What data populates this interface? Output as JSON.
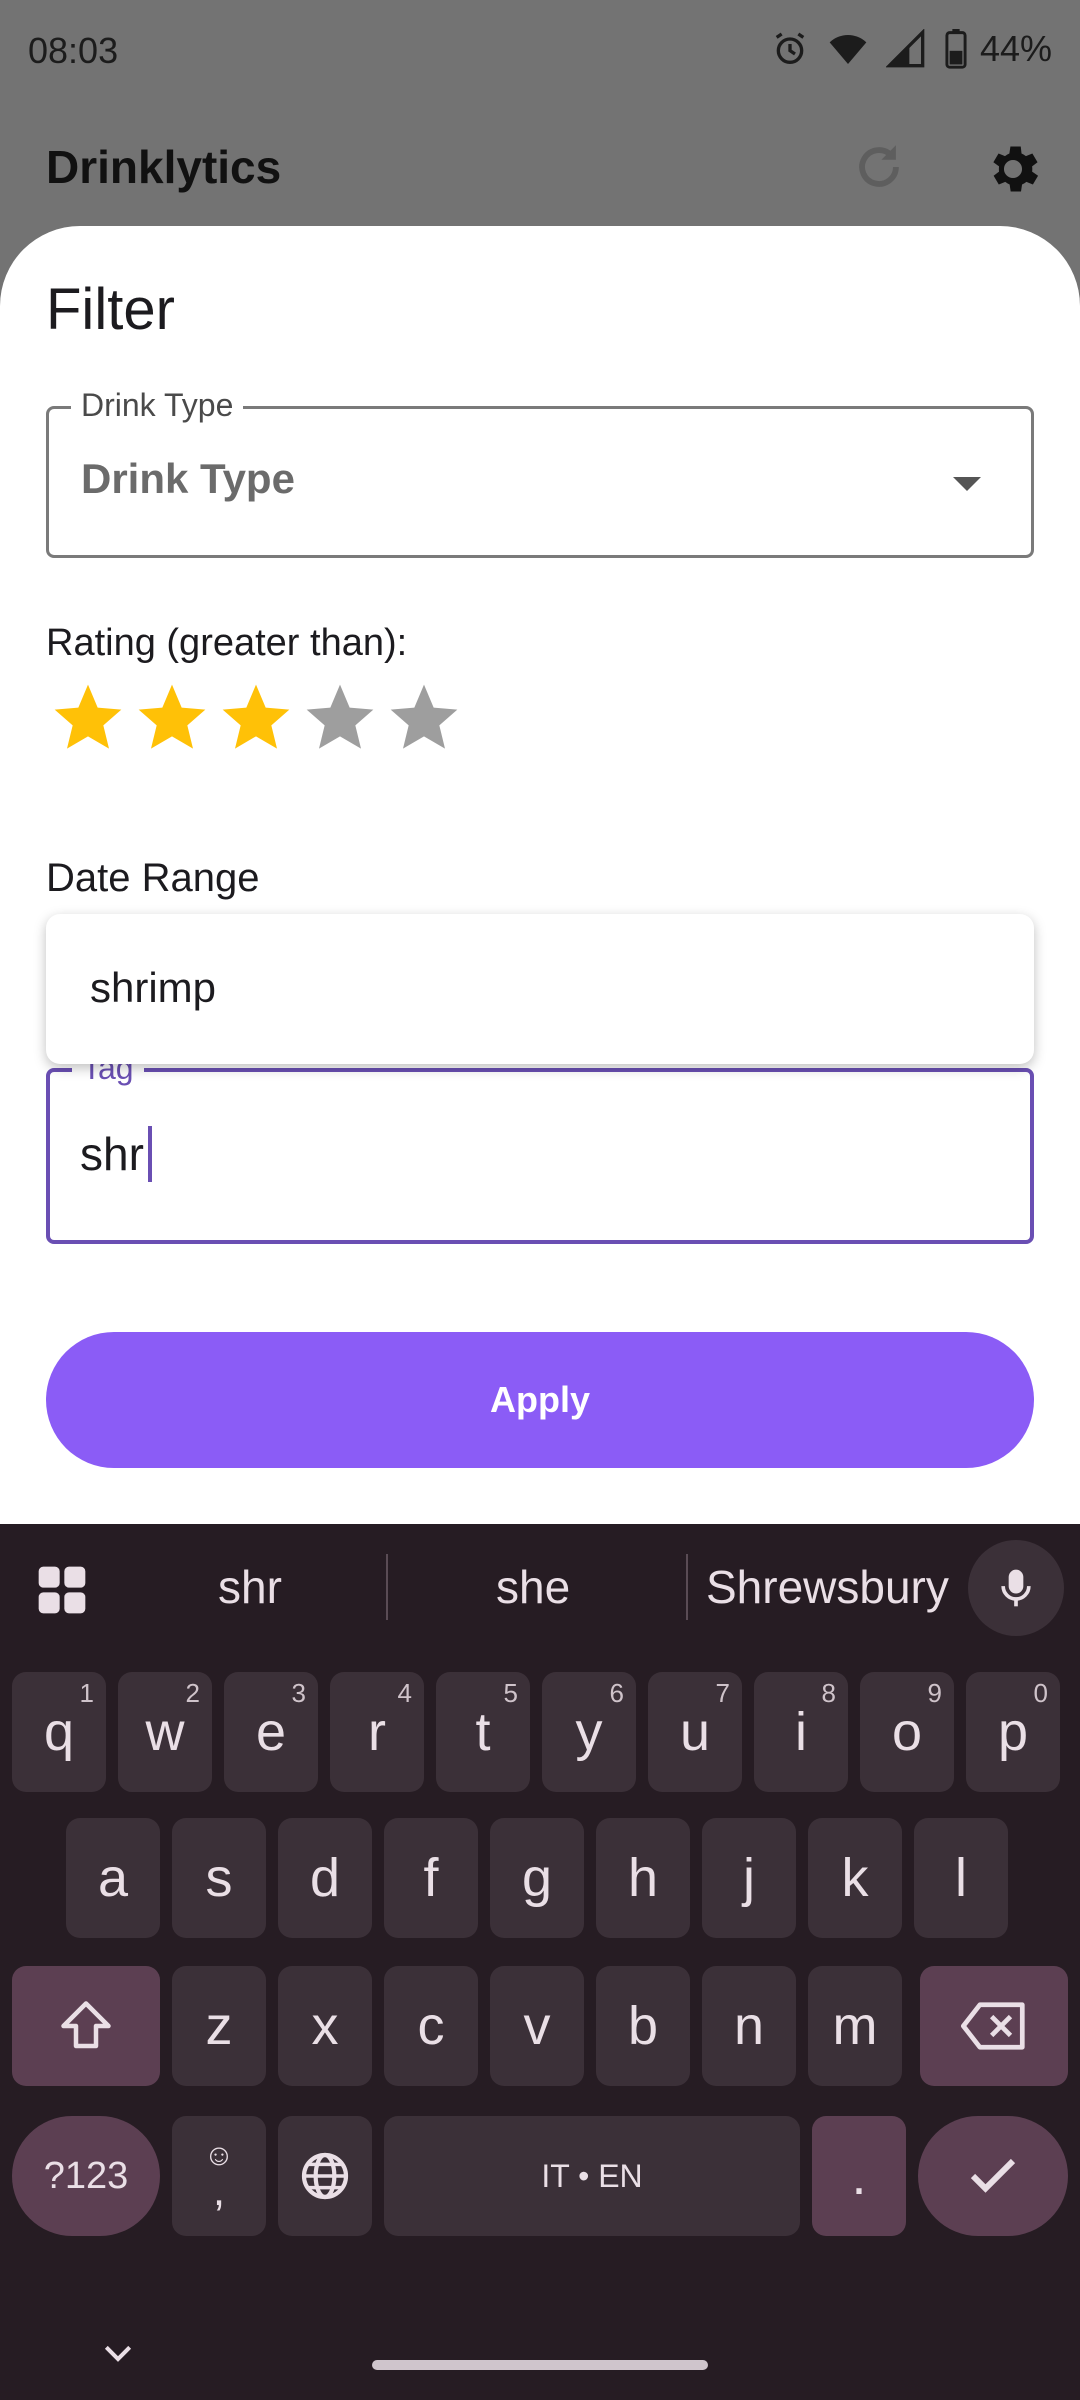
{
  "status_bar": {
    "time": "08:03",
    "battery": "44%"
  },
  "app_bar": {
    "title": "Drinklytics"
  },
  "filter_sheet": {
    "title": "Filter",
    "drink_type": {
      "label": "Drink Type",
      "value": "Drink Type"
    },
    "rating": {
      "label": "Rating (greater than):",
      "value": 3,
      "max": 5
    },
    "date_range": {
      "label": "Date Range"
    },
    "tag": {
      "label": "Tag",
      "value": "shr"
    },
    "autocomplete": {
      "suggestions": [
        "shrimp"
      ]
    },
    "apply_label": "Apply"
  },
  "keyboard": {
    "suggestions": [
      "shr",
      "she",
      "Shrewsbury"
    ],
    "rows": [
      [
        {
          "k": "q",
          "h": "1"
        },
        {
          "k": "w",
          "h": "2"
        },
        {
          "k": "e",
          "h": "3"
        },
        {
          "k": "r",
          "h": "4"
        },
        {
          "k": "t",
          "h": "5"
        },
        {
          "k": "y",
          "h": "6"
        },
        {
          "k": "u",
          "h": "7"
        },
        {
          "k": "i",
          "h": "8"
        },
        {
          "k": "o",
          "h": "9"
        },
        {
          "k": "p",
          "h": "0"
        }
      ],
      [
        {
          "k": "a"
        },
        {
          "k": "s"
        },
        {
          "k": "d"
        },
        {
          "k": "f"
        },
        {
          "k": "g"
        },
        {
          "k": "h"
        },
        {
          "k": "j"
        },
        {
          "k": "k"
        },
        {
          "k": "l"
        }
      ],
      [
        {
          "k": "z"
        },
        {
          "k": "x"
        },
        {
          "k": "c"
        },
        {
          "k": "v"
        },
        {
          "k": "b"
        },
        {
          "k": "n"
        },
        {
          "k": "m"
        }
      ]
    ],
    "symbols_label": "?123",
    "comma_label": ",",
    "space_label": "IT • EN",
    "period_label": "."
  },
  "colors": {
    "accent": "#8b5cf6",
    "focus": "#6a4fb3",
    "star_on": "#ffc107",
    "star_off": "#9e9e9e",
    "keyboard_bg": "#261c23"
  }
}
